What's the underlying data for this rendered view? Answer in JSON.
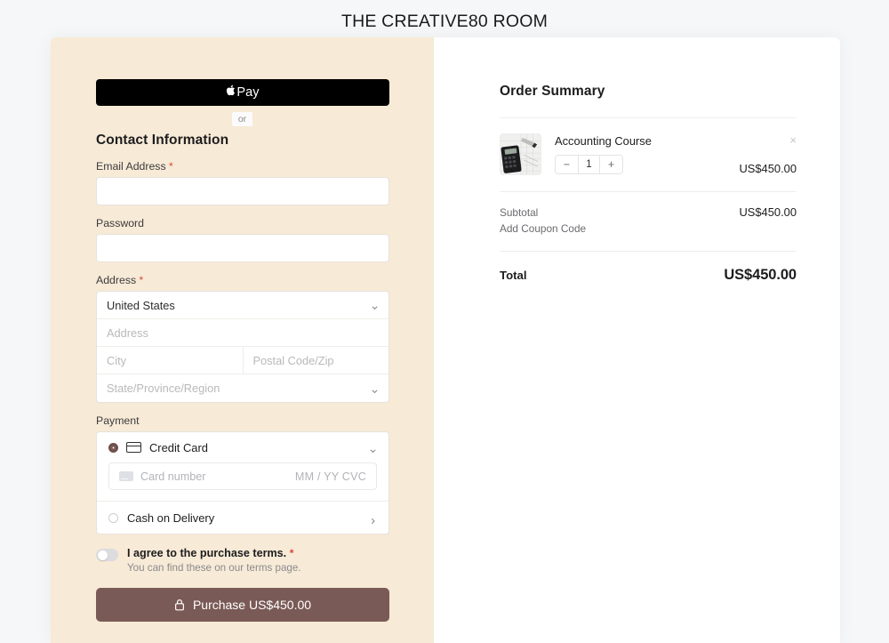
{
  "page": {
    "title": "THE CREATIVE80 ROOM",
    "background": "#f6f7f9",
    "left_pane_color": "#f7ead6",
    "accent_color": "#7a5a56",
    "required_marker_color": "#d9483b"
  },
  "express": {
    "apple_pay_label": "Pay",
    "apple_glyph": "",
    "divider_label": "or"
  },
  "contact": {
    "heading": "Contact Information",
    "email_label": "Email Address",
    "email_required": "*",
    "email_value": "",
    "email_placeholder": "",
    "password_label": "Password",
    "password_value": "",
    "password_placeholder": ""
  },
  "address": {
    "label": "Address",
    "required": "*",
    "country_value": "United States",
    "street_placeholder": "Address",
    "street_value": "",
    "city_placeholder": "City",
    "city_value": "",
    "postal_placeholder": "Postal Code/Zip",
    "postal_value": "",
    "state_placeholder": "State/Province/Region"
  },
  "payment": {
    "label": "Payment",
    "methods": [
      {
        "id": "credit-card",
        "label": "Credit Card",
        "selected": true
      },
      {
        "id": "cash-on-delivery",
        "label": "Cash on Delivery",
        "selected": false
      }
    ],
    "card_number_placeholder": "Card number",
    "card_expiry_placeholder": "MM / YY",
    "card_cvc_placeholder": "CVC",
    "card_expiry_cvc": "MM / YY  CVC"
  },
  "terms": {
    "agree_label": "I agree to the purchase terms.",
    "required": "*",
    "sub_label": "You can find these on our terms page.",
    "toggle_state": "off"
  },
  "purchase": {
    "button_label": "Purchase US$450.00"
  },
  "summary": {
    "heading": "Order Summary",
    "items": [
      {
        "name": "Accounting Course",
        "quantity": "1",
        "price": "US$450.00",
        "decrement_label": "−",
        "increment_label": "+",
        "remove_label": "×",
        "thumbnail": "accounting-calculator-photo"
      }
    ],
    "subtotal_label": "Subtotal",
    "subtotal_value": "US$450.00",
    "coupon_label": "Add Coupon Code",
    "total_label": "Total",
    "total_value": "US$450.00"
  }
}
